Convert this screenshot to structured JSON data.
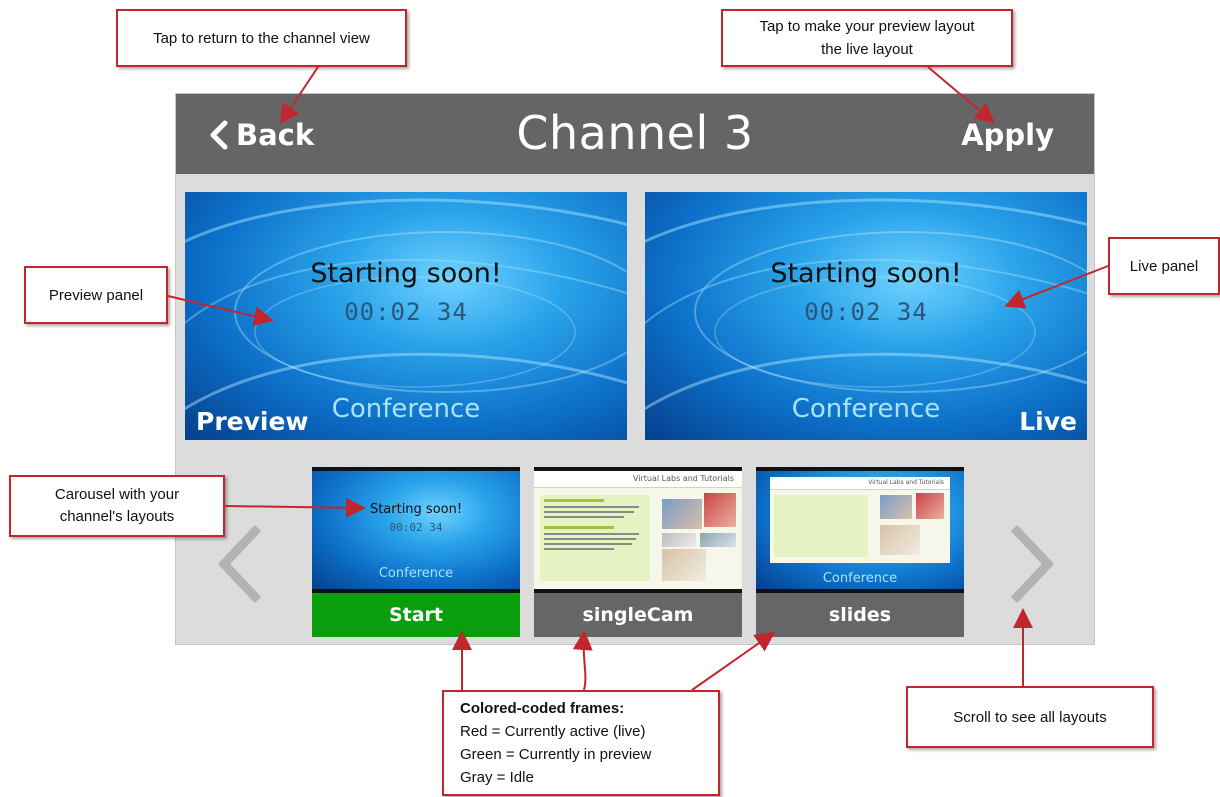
{
  "device": {
    "header": {
      "back_label": "Back",
      "title": "Channel 3",
      "apply_label": "Apply"
    },
    "preview_panel": {
      "slide_title": "Starting soon!",
      "timer": "00:02 34",
      "brand": "Conference",
      "tag": "Preview"
    },
    "live_panel": {
      "slide_title": "Starting soon!",
      "timer": "00:02 34",
      "brand": "Conference",
      "tag": "Live"
    },
    "carousel": {
      "items": [
        {
          "label": "Start",
          "frame_color": "#0a9e0f",
          "slide_title": "Starting soon!",
          "timer": "00:02 34",
          "brand": "Conference"
        },
        {
          "label": "singleCam",
          "frame_color": "#666666",
          "header_text": "Virtual Labs and Tutorials"
        },
        {
          "label": "slides",
          "frame_color": "#666666",
          "header_text": "Virtual Labs and Tutorials",
          "brand": "Conference"
        }
      ]
    }
  },
  "callouts": {
    "back": "Tap to return to the channel view",
    "apply": [
      "Tap to make your preview layout",
      "the live layout"
    ],
    "preview": "Preview panel",
    "live": "Live panel",
    "carousel": [
      "Carousel with your",
      "channel's layouts"
    ],
    "scroll": "Scroll to see all layouts",
    "legend": {
      "title": "Colored-coded frames:",
      "lines": [
        "Red = Currently active (live)",
        "Green = Currently in preview",
        "Gray = Idle"
      ]
    }
  },
  "colors": {
    "topbar": "#656565",
    "active_preview": "#0a9e0f",
    "idle": "#666666",
    "annotation": "#c0272d"
  }
}
